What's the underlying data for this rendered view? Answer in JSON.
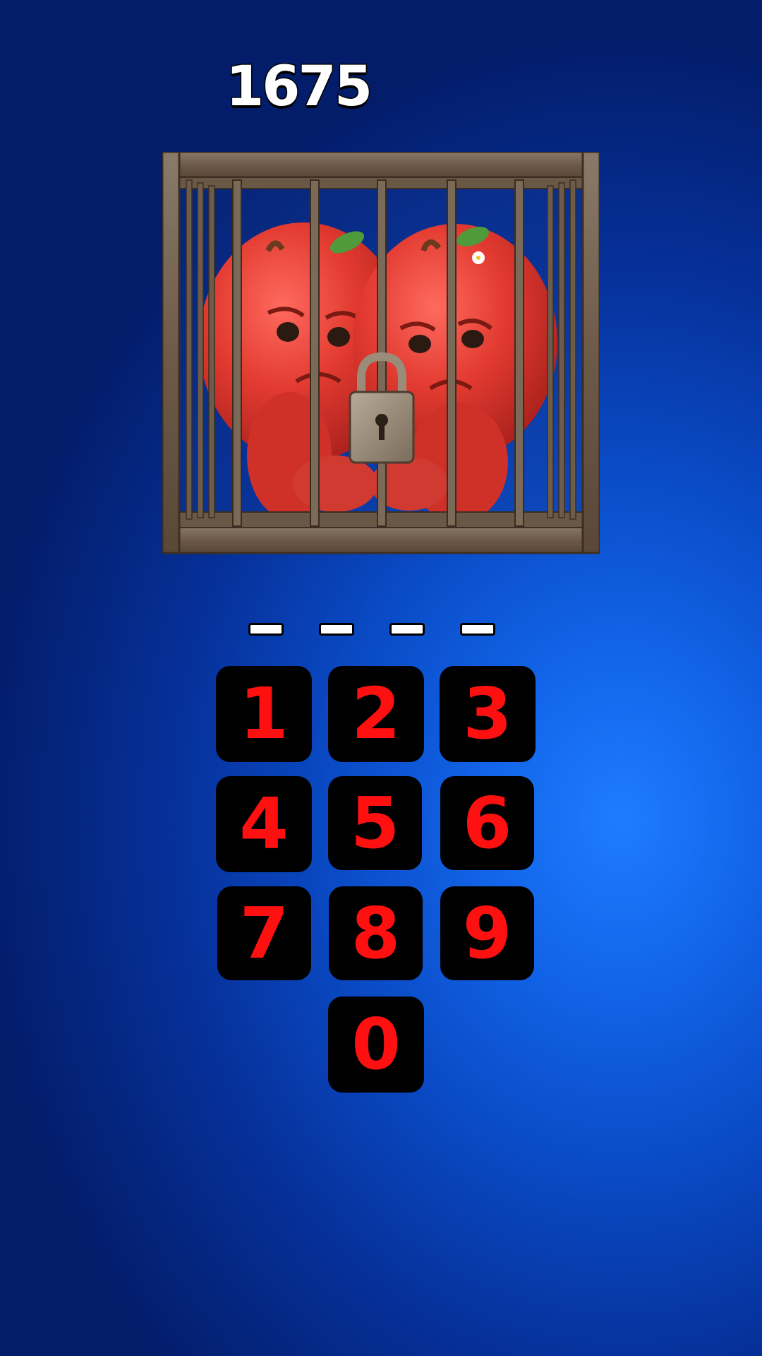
{
  "score": "1675",
  "code_slots": [
    "",
    "",
    "",
    ""
  ],
  "keypad": {
    "keys": [
      "1",
      "2",
      "3",
      "4",
      "5",
      "6",
      "7",
      "8",
      "9",
      "0"
    ]
  },
  "colors": {
    "background_center": "#1f7cff",
    "background_edge": "#031d6b",
    "key_background": "#000000",
    "key_digit": "#ff1010",
    "score_text": "#ffffff"
  },
  "scene": {
    "icon": "caged-apples-with-padlock"
  }
}
